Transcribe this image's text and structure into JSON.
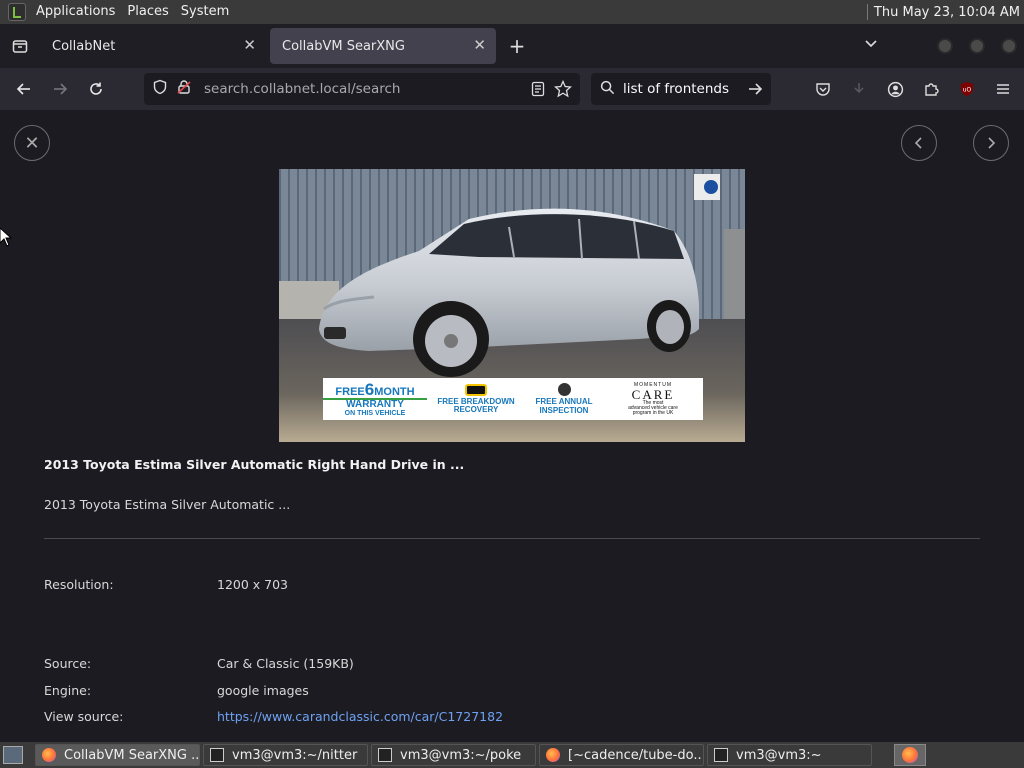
{
  "top_panel": {
    "menus": [
      "Applications",
      "Places",
      "System"
    ],
    "clock": "Thu May 23, 10:04 AM"
  },
  "tabs": [
    {
      "label": "CollabNet"
    },
    {
      "label": "CollabVM SearXNG"
    }
  ],
  "nav": {
    "url_host": "search.collabnet.local",
    "url_path": "/search",
    "search_value": "list of frontends"
  },
  "result": {
    "title": "2013 Toyota Estima Silver Automatic Right Hand Drive in ...",
    "description": "2013 Toyota Estima Silver Automatic ...",
    "resolution_label": "Resolution:",
    "resolution_value": "1200 x 703",
    "source_label": "Source:",
    "source_value": "Car & Classic (159KB)",
    "engine_label": "Engine:",
    "engine_value": "google images",
    "view_source_label": "View source:",
    "view_source_value": "https://www.carandclassic.com/car/C1727182"
  },
  "banner": {
    "free": "FREE",
    "six": "6",
    "month": "MONTH",
    "warranty": "WARRANTY",
    "on_vehicle": "ON THIS VEHICLE",
    "breakdown": "FREE BREAKDOWN",
    "recovery": "RECOVERY",
    "annual": "FREE ANNUAL",
    "inspection": "INSPECTION",
    "momentum": "MOMENTUM",
    "care": "CARE",
    "care_sub1": "The most",
    "care_sub2": "advanced vehicle care",
    "care_sub3": "program in the UK"
  },
  "taskbar": [
    {
      "label": "CollabVM SearXNG ...",
      "icon": "firefox-icon",
      "active": true
    },
    {
      "label": "vm3@vm3:~/nitter",
      "icon": "terminal-icon",
      "active": false
    },
    {
      "label": "vm3@vm3:~/poke",
      "icon": "terminal-icon",
      "active": false
    },
    {
      "label": "[~cadence/tube-do...",
      "icon": "firefox-icon",
      "active": false
    },
    {
      "label": "vm3@vm3:~",
      "icon": "terminal-icon",
      "active": false
    }
  ],
  "colors": {
    "link": "#6ea2f2",
    "background": "#1c1b22",
    "toolbar": "#2b2a33"
  }
}
